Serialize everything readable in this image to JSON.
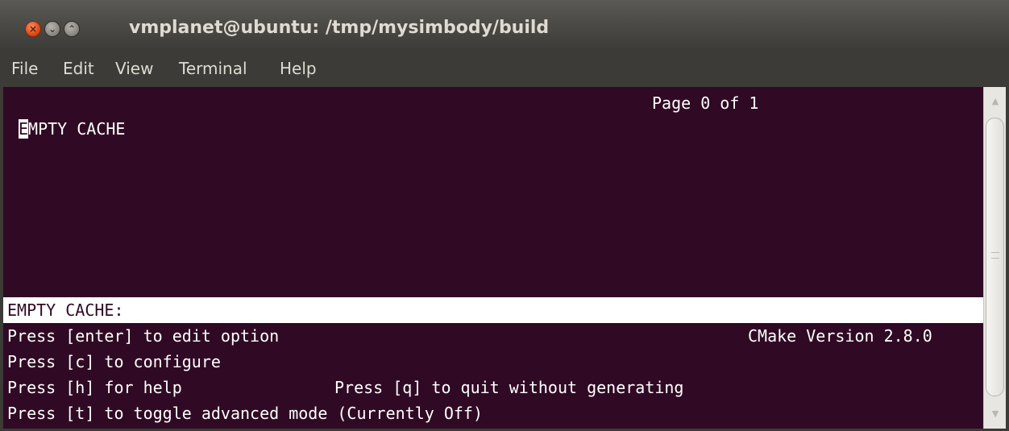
{
  "window": {
    "title": "vmplanet@ubuntu: /tmp/mysimbody/build",
    "buttons": {
      "close": "×",
      "minimize": "⌄",
      "maximize": "⌃"
    }
  },
  "menu": {
    "items": [
      "File",
      "Edit",
      "View",
      "Terminal",
      "Help"
    ]
  },
  "terminal": {
    "page_indicator": "Page 0 of 1",
    "cursor_char": "E",
    "cache_label_rest": "MPTY CACHE",
    "status_bar": "EMPTY CACHE:",
    "help_line1": "Press [enter] to edit option",
    "cmake_version": "CMake Version 2.8.0",
    "help_line2": "Press [c] to configure",
    "help_line3a": "Press [h] for help",
    "help_line3b": "Press [q] to quit without generating",
    "help_line4": "Press [t] to toggle advanced mode (Currently Off)"
  },
  "scrollbar": {
    "up_arrow": "▲",
    "down_arrow": "▼"
  },
  "colors": {
    "terminal_bg": "#300a24",
    "terminal_fg": "#ffffff",
    "chrome_bg": "#3c3b37",
    "chrome_text": "#dfdbd2",
    "close_button": "#df4a16"
  }
}
